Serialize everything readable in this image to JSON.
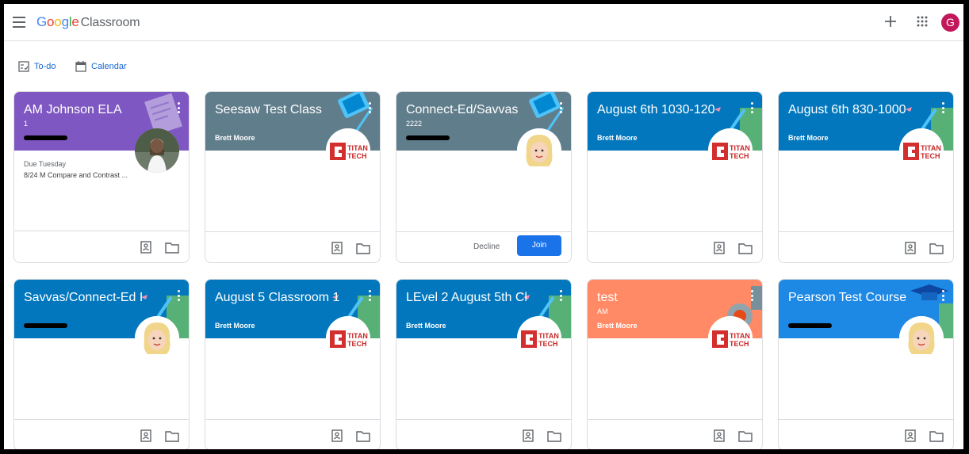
{
  "app": {
    "logo_google": "Google",
    "logo_product": "Classroom",
    "avatar_letter": "G"
  },
  "nav": {
    "todo": "To-do",
    "calendar": "Calendar"
  },
  "colors": {
    "purple": "#7e57c2",
    "slate": "#607d8b",
    "blue": "#0277bd",
    "bright_blue": "#1e88e5",
    "coral": "#ff8a65",
    "join": "#1a73e8"
  },
  "cards": [
    {
      "title": "AM Johnson ELA",
      "section": "1",
      "owner": "",
      "due_label": "Due Tuesday",
      "due_text": "8/24 M Compare and Contrast ...",
      "photo": "person-photo"
    },
    {
      "title": "Seesaw Test Class",
      "owner": "Brett Moore",
      "photo": "titan-tech-logo"
    },
    {
      "title": "Connect-Ed/Savvas",
      "section": "2222",
      "owner": "",
      "photo": "bitmoji-avatar",
      "decline": "Decline",
      "join": "Join"
    },
    {
      "title": "August 6th 1030-120",
      "owner": "Brett Moore",
      "photo": "titan-tech-logo"
    },
    {
      "title": "August 6th 830-1000",
      "owner": "Brett Moore",
      "photo": "titan-tech-logo"
    },
    {
      "title": "Savvas/Connect-Ed I",
      "owner": "",
      "photo": "bitmoji-avatar"
    },
    {
      "title": "August 5 Classroom 1",
      "owner": "Brett Moore",
      "photo": "titan-tech-logo"
    },
    {
      "title": "LEvel 2 August 5th Cl",
      "owner": "Brett Moore",
      "photo": "titan-tech-logo"
    },
    {
      "title": "test",
      "section": "AM",
      "owner": "Brett Moore",
      "photo": "titan-tech-logo"
    },
    {
      "title": "Pearson Test Course",
      "owner": "",
      "photo": "bitmoji-avatar"
    }
  ],
  "logo_text": {
    "titan": "TITAN",
    "tech": "TECH"
  }
}
